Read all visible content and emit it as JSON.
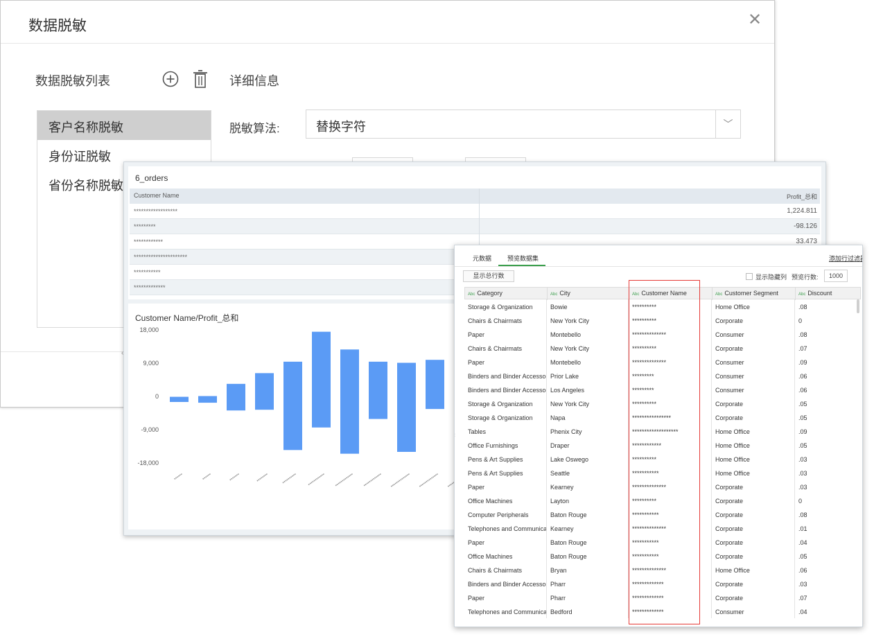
{
  "mask_dialog": {
    "title": "数据脱敏",
    "list_heading": "数据脱敏列表",
    "detail_heading": "详细信息",
    "rules": [
      "客户名称脱敏",
      "身份证脱敏",
      "省份名称脱敏"
    ],
    "selected_rule_index": 0,
    "algorithm_label": "脱敏算法:",
    "algorithm_value": "替换字符",
    "icons": {
      "add": "add-circle-icon",
      "delete": "trash-icon",
      "close": "close-icon",
      "dropdown": "chevron-down-icon"
    }
  },
  "report": {
    "table_title": "6_orders",
    "table_headers": [
      "Customer Name",
      "Profit_总和"
    ],
    "table_rows": [
      {
        "name": "******************",
        "profit": "1,224.811"
      },
      {
        "name": "*********",
        "profit": "-98.126"
      },
      {
        "name": "************",
        "profit": "33.473"
      },
      {
        "name": "**********************",
        "profit": ""
      },
      {
        "name": "***********",
        "profit": ""
      },
      {
        "name": "*************",
        "profit": ""
      }
    ],
    "chart_title": "Customer Name/Profit_总和",
    "bar_color": "#5b9bf5"
  },
  "chart_data": {
    "type": "bar",
    "title": "Customer Name/Profit_总和",
    "xlabel": "",
    "ylabel": "",
    "ylim": [
      -18000,
      18000
    ],
    "yticks": [
      "18,000",
      "9,000",
      "0",
      "-9,000",
      "-18,000"
    ],
    "categories": [
      "******",
      "******",
      "*******",
      "********",
      "**********",
      "************",
      "*************",
      "*************",
      "**************",
      "**************",
      "**************"
    ],
    "ranges": [
      [
        -1500,
        -100
      ],
      [
        -1700,
        100
      ],
      [
        -3800,
        3400
      ],
      [
        -3600,
        6300
      ],
      [
        -14500,
        9400
      ],
      [
        -8400,
        17500
      ],
      [
        -15500,
        12700
      ],
      [
        -6100,
        9400
      ],
      [
        -15000,
        9100
      ],
      [
        -3400,
        9900
      ],
      [
        -9200,
        12000
      ]
    ]
  },
  "preview": {
    "tabs": [
      "元数据",
      "预览数据集"
    ],
    "active_tab": 1,
    "add_filter": "添加行过滤器",
    "show_total_btn": "显示总行数",
    "show_hidden_label": "显示隐藏列",
    "preview_rows_label": "预览行数:",
    "preview_rows_value": "1000",
    "type_tag": "Abc",
    "columns": [
      "Category",
      "City",
      "Customer Name",
      "Customer Segment",
      "Discount"
    ],
    "rows": [
      [
        "Storage & Organization",
        "Bowie",
        "**********",
        "Home Office",
        ".08"
      ],
      [
        "Chairs & Chairmats",
        "New York City",
        "**********",
        "Corporate",
        "0"
      ],
      [
        "Paper",
        "Montebello",
        "**************",
        "Consumer",
        ".08"
      ],
      [
        "Chairs & Chairmats",
        "New York City",
        "**********",
        "Corporate",
        ".07"
      ],
      [
        "Paper",
        "Montebello",
        "**************",
        "Consumer",
        ".09"
      ],
      [
        "Binders and Binder Accessor...",
        "Prior Lake",
        "*********",
        "Consumer",
        ".06"
      ],
      [
        "Binders and Binder Accessor...",
        "Los Angeles",
        "*********",
        "Consumer",
        ".06"
      ],
      [
        "Storage & Organization",
        "New York City",
        "**********",
        "Corporate",
        ".05"
      ],
      [
        "Storage & Organization",
        "Napa",
        "****************",
        "Corporate",
        ".05"
      ],
      [
        "Tables",
        "Phenix City",
        "*******************",
        "Home Office",
        ".09"
      ],
      [
        "Office Furnishings",
        "Draper",
        "************",
        "Home Office",
        ".05"
      ],
      [
        "Pens & Art Supplies",
        "Lake Oswego",
        "**********",
        "Home Office",
        ".03"
      ],
      [
        "Pens & Art Supplies",
        "Seattle",
        "***********",
        "Home Office",
        ".03"
      ],
      [
        "Paper",
        "Kearney",
        "**************",
        "Corporate",
        ".03"
      ],
      [
        "Office Machines",
        "Layton",
        "**********",
        "Corporate",
        "0"
      ],
      [
        "Computer Peripherals",
        "Baton Rouge",
        "***********",
        "Corporate",
        ".08"
      ],
      [
        "Telephones and Communica...",
        "Kearney",
        "**************",
        "Corporate",
        ".01"
      ],
      [
        "Paper",
        "Baton Rouge",
        "***********",
        "Corporate",
        ".04"
      ],
      [
        "Office Machines",
        "Baton Rouge",
        "***********",
        "Corporate",
        ".05"
      ],
      [
        "Chairs & Chairmats",
        "Bryan",
        "**************",
        "Home Office",
        ".06"
      ],
      [
        "Binders and Binder Accessor...",
        "Pharr",
        "*************",
        "Corporate",
        ".03"
      ],
      [
        "Paper",
        "Pharr",
        "*************",
        "Corporate",
        ".07"
      ],
      [
        "Telephones and Communica...",
        "Bedford",
        "*************",
        "Consumer",
        ".04"
      ]
    ],
    "highlight_color": "#e53935"
  }
}
